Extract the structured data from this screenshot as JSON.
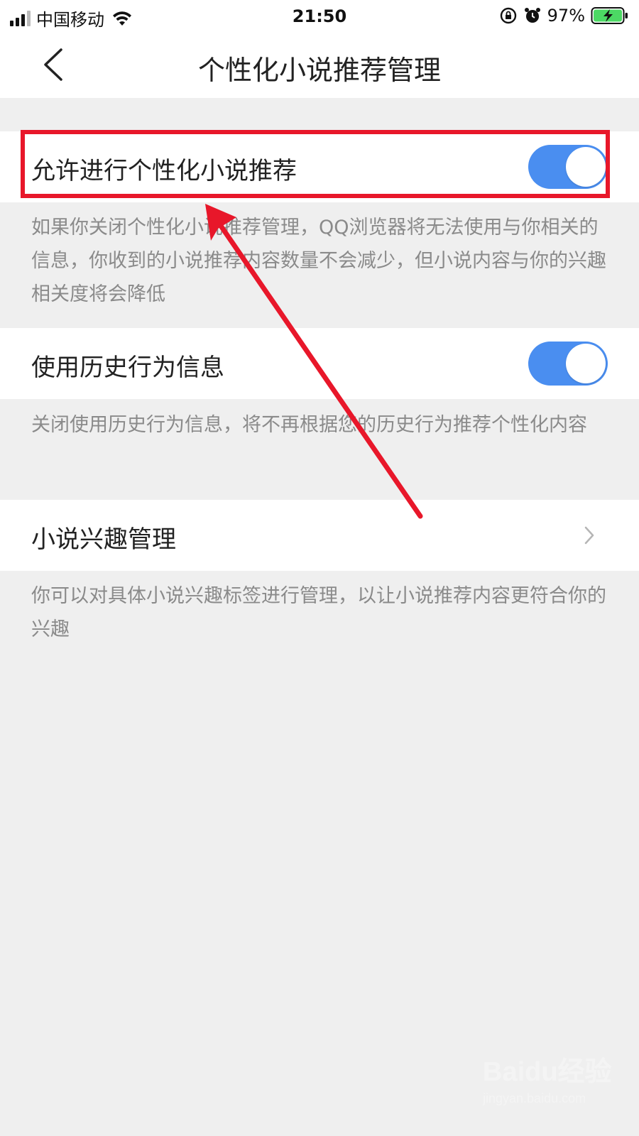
{
  "status_bar": {
    "carrier": "中国移动",
    "time": "21:50",
    "battery_percent": "97%",
    "icons": [
      "signal-icon",
      "wifi-icon",
      "rotation-lock-icon",
      "alarm-icon",
      "battery-charging-icon"
    ]
  },
  "nav": {
    "title": "个性化小说推荐管理",
    "back_icon": "chevron-left-icon"
  },
  "settings": [
    {
      "label": "允许进行个性化小说推荐",
      "type": "toggle",
      "enabled": true,
      "description": "如果你关闭个性化小说推荐管理，QQ浏览器将无法使用与你相关的信息，你收到的小说推荐内容数量不会减少，但小说内容与你的兴趣相关度将会降低"
    },
    {
      "label": "使用历史行为信息",
      "type": "toggle",
      "enabled": true,
      "description": "关闭使用历史行为信息，将不再根据您的历史行为推荐个性化内容"
    },
    {
      "label": "小说兴趣管理",
      "type": "link",
      "description": "你可以对具体小说兴趣标签进行管理，以让小说推荐内容更符合你的兴趣"
    }
  ],
  "colors": {
    "toggle_on": "#4a8ef0",
    "annotation_red": "#e8172a",
    "background": "#efefef",
    "description_text": "#8a8a8a"
  },
  "watermark": {
    "logo": "Baidu经验",
    "url": "jingyan.baidu.com"
  }
}
